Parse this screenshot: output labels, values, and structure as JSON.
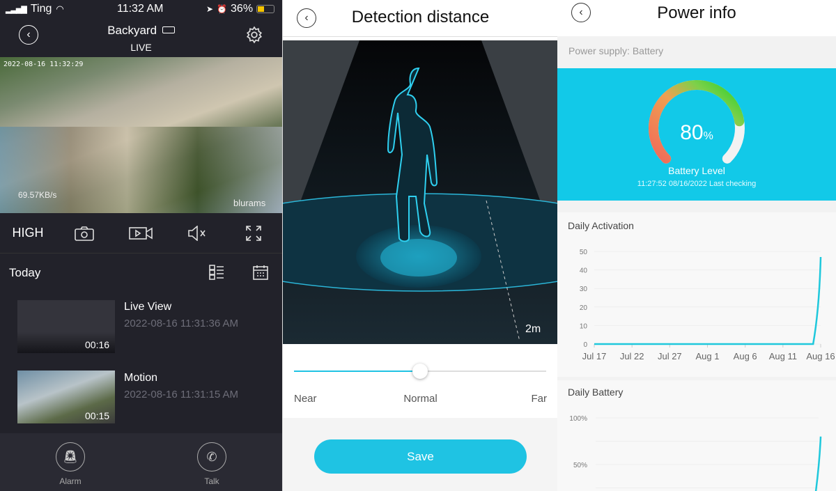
{
  "colors": {
    "accent": "#1fc3e3",
    "gauge_bg": "#12c9e8",
    "dark_bg": "#22222a"
  },
  "camera": {
    "status_bar": {
      "carrier": "Ting",
      "time": "11:32 AM",
      "battery": "36%"
    },
    "title": "Backyard",
    "subtitle": "LIVE",
    "feed": {
      "timestamp": "2022-08-16 11:32:29",
      "bitrate": "69.57KB/s",
      "watermark": "blurams"
    },
    "controls": {
      "quality": "HIGH",
      "icons": [
        "camera-icon",
        "record-video-icon",
        "mute-icon",
        "fullscreen-icon"
      ]
    },
    "list_header": "Today",
    "recordings": [
      {
        "title": "Live View",
        "time": "2022-08-16 11:31:36 AM",
        "duration": "00:16"
      },
      {
        "title": "Motion",
        "time": "2022-08-16 11:31:15 AM",
        "duration": "00:15"
      }
    ],
    "tabs": [
      {
        "label": "Alarm",
        "icon": "alarm-icon"
      },
      {
        "label": "Talk",
        "icon": "phone-icon"
      }
    ]
  },
  "detection": {
    "title": "Detection distance",
    "distance_label": "2m",
    "slider": {
      "min_label": "Near",
      "mid_label": "Normal",
      "max_label": "Far",
      "value": "Normal",
      "fraction": 0.5
    },
    "save_label": "Save"
  },
  "power": {
    "title": "Power info",
    "supply": "Power supply: Battery",
    "battery_percent": 80,
    "battery_value": "80",
    "battery_unit": "%",
    "battery_label": "Battery Level",
    "last_check": "11:27:52 08/16/2022 Last checking"
  },
  "chart_data": [
    {
      "type": "line",
      "title": "Daily Activation",
      "x_ticks": [
        "Jul 17",
        "Jul 22",
        "Jul 27",
        "Aug 1",
        "Aug 6",
        "Aug 11",
        "Aug 16"
      ],
      "y_ticks": [
        "0",
        "10",
        "20",
        "30",
        "40",
        "50"
      ],
      "ylim": [
        0,
        50
      ],
      "x_range": [
        "Jul 17",
        "Aug 16"
      ],
      "series": [
        {
          "x": [
            "Jul 17",
            "Aug 15",
            "Aug 16"
          ],
          "values": [
            0,
            0,
            47
          ]
        }
      ],
      "grid": true
    },
    {
      "type": "line",
      "title": "Daily Battery",
      "y_ticks": [
        "100%",
        "50%"
      ],
      "ylim": [
        0,
        100
      ],
      "series": [
        {
          "x": [
            "Aug 15",
            "Aug 16"
          ],
          "values": [
            0,
            80
          ]
        }
      ],
      "grid": true
    }
  ]
}
